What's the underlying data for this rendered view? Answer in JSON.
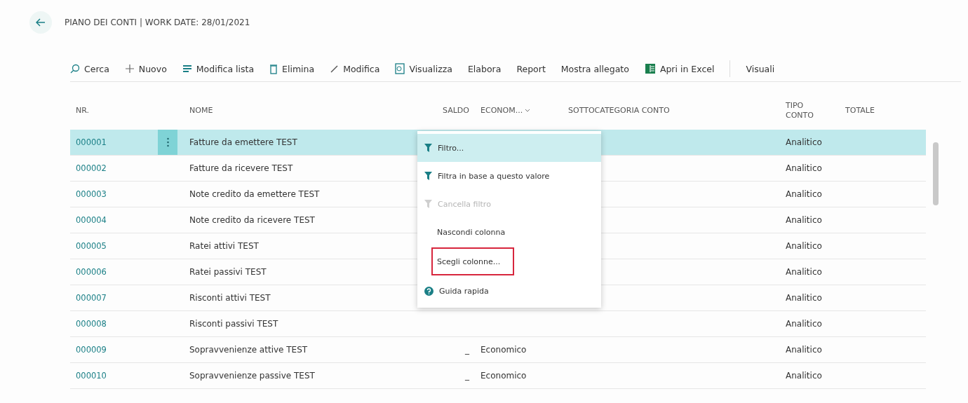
{
  "page": {
    "title": "PIANO DEI CONTI | WORK DATE: 28/01/2021"
  },
  "toolbar": [
    {
      "label": "Cerca",
      "kind": "search"
    },
    {
      "label": "Nuovo",
      "kind": "plus"
    },
    {
      "label": "Modifica lista",
      "kind": "list"
    },
    {
      "label": "Elimina",
      "kind": "trash"
    },
    {
      "label": "Modifica",
      "kind": "pencil"
    },
    {
      "label": "Visualizza",
      "kind": "view"
    },
    {
      "label": "Elabora",
      "kind": "text"
    },
    {
      "label": "Report",
      "kind": "text"
    },
    {
      "label": "Mostra allegato",
      "kind": "text"
    },
    {
      "label": "Apri in Excel",
      "kind": "excel"
    },
    {
      "label": "Visuali",
      "kind": "text"
    }
  ],
  "table": {
    "columns": [
      {
        "label": "NR."
      },
      {
        "label": "NOME"
      },
      {
        "label": "SALDO"
      },
      {
        "label": "ECONOM...",
        "sort": true
      },
      {
        "label": "SOTTOCATEGORIA CONTO"
      },
      {
        "label": "TIPO CONTO"
      },
      {
        "label": "TOTALE"
      }
    ],
    "rows": [
      {
        "nr": "000001",
        "nome": "Fatture da emettere TEST",
        "tipo": "Analitico",
        "selected": true
      },
      {
        "nr": "000002",
        "nome": "Fatture da ricevere TEST",
        "tipo": "Analitico",
        "selected": false
      },
      {
        "nr": "000003",
        "nome": "Note credito da emettere TEST",
        "tipo": "Analitico",
        "selected": false
      },
      {
        "nr": "000004",
        "nome": "Note credito da ricevere TEST",
        "tipo": "Analitico",
        "selected": false
      },
      {
        "nr": "000005",
        "nome": "Ratei attivi TEST",
        "tipo": "Analitico",
        "selected": false
      },
      {
        "nr": "000006",
        "nome": "Ratei passivi TEST",
        "tipo": "Analitico",
        "selected": false
      },
      {
        "nr": "000007",
        "nome": "Risconti attivi TEST",
        "tipo": "Analitico",
        "selected": false
      },
      {
        "nr": "000008",
        "nome": "Risconti passivi TEST",
        "tipo": "Analitico",
        "selected": false
      },
      {
        "nr": "000009",
        "nome": "Sopravvenienze attive TEST",
        "saldo": "_",
        "economico": "Economico",
        "tipo": "Analitico",
        "selected": false
      },
      {
        "nr": "000010",
        "nome": "Sopravvenienze passive TEST",
        "saldo": "_",
        "economico": "Economico",
        "tipo": "Analitico",
        "selected": false
      }
    ]
  },
  "context_menu": [
    {
      "label": "Filtro...",
      "kind": "filter",
      "disabled": false,
      "highlighted": false,
      "selected": true
    },
    {
      "label": "Filtra in base a questo valore",
      "kind": "filter",
      "disabled": false,
      "highlighted": false,
      "selected": false
    },
    {
      "label": "Cancella filtro",
      "kind": "clear",
      "disabled": true,
      "highlighted": false,
      "selected": false
    },
    {
      "label": "Nascondi colonna",
      "kind": "plain",
      "disabled": false,
      "highlighted": false,
      "selected": false
    },
    {
      "label": "Scegli colonne...",
      "kind": "plain",
      "disabled": false,
      "highlighted": true,
      "selected": false
    },
    {
      "label": "Guida rapida",
      "kind": "help",
      "disabled": false,
      "highlighted": false,
      "selected": false
    }
  ]
}
